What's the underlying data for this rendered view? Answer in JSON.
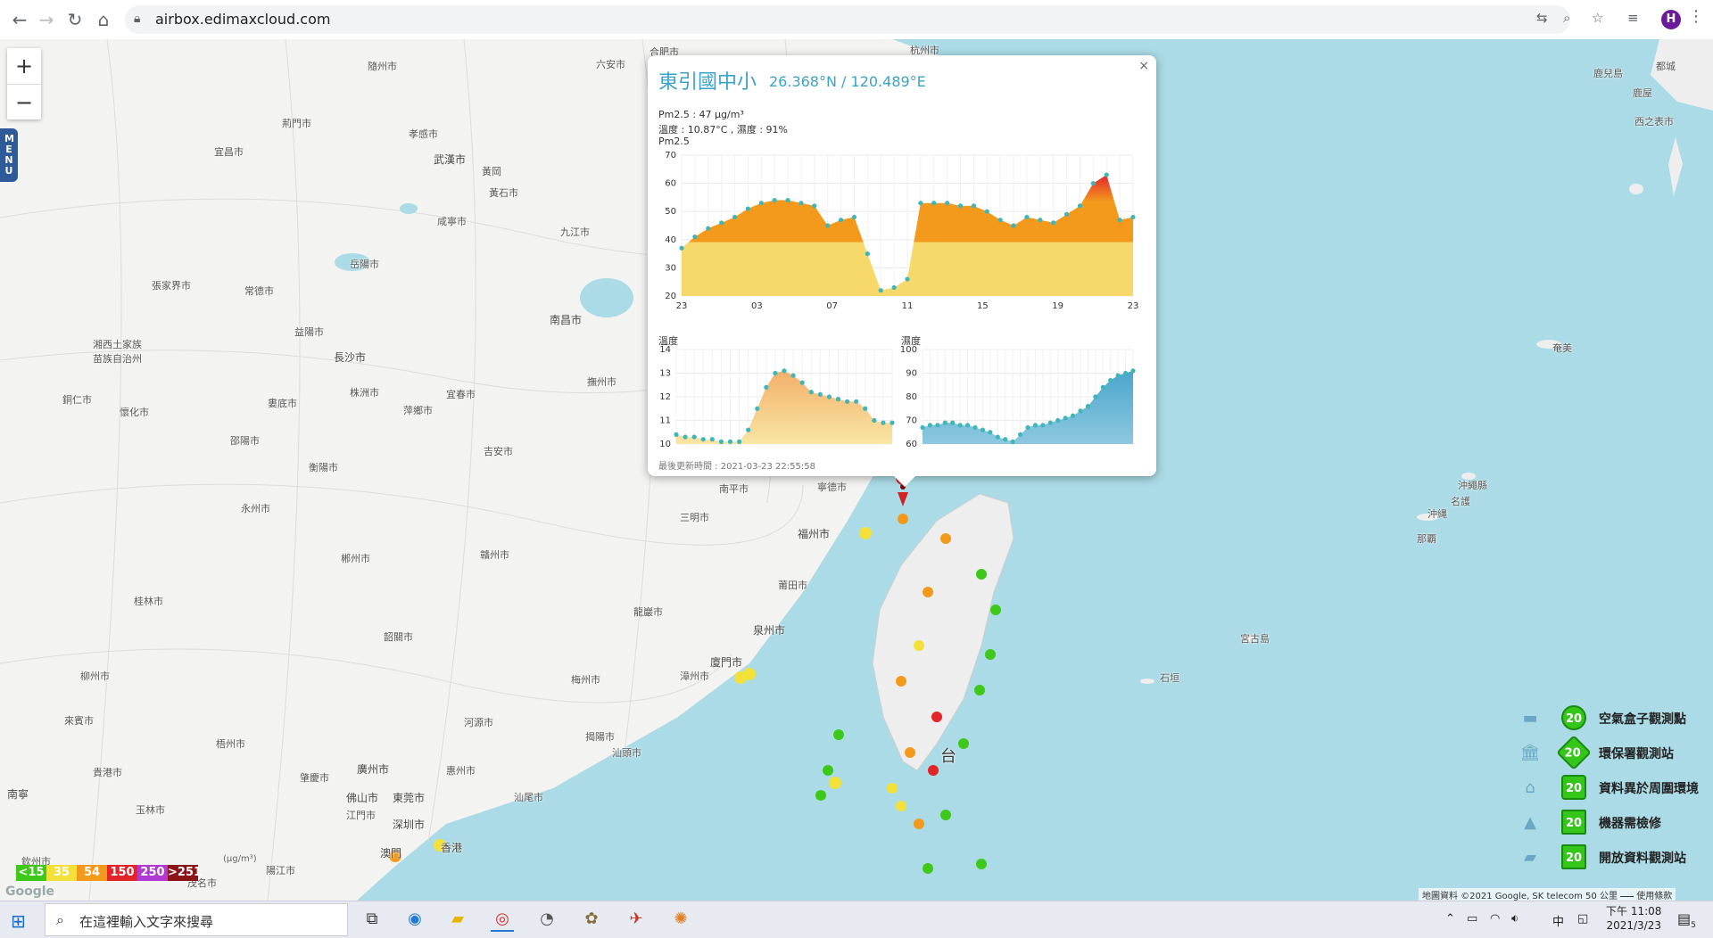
{
  "browser": {
    "url": "airbox.edimaxcloud.com",
    "profile_initial": "H",
    "icons": [
      "back-icon",
      "forward-icon",
      "reload-icon",
      "home-icon",
      "lock-icon",
      "translate-icon",
      "zoom-icon",
      "star-icon",
      "reading-list-icon",
      "menu-icon"
    ]
  },
  "map": {
    "zoom_in": "+",
    "zoom_out": "−",
    "menu_tab": "MENU",
    "labels": [
      {
        "t": "隨州市"
      },
      {
        "t": "荊門市"
      },
      {
        "t": "孝感市"
      },
      {
        "t": "宜昌市"
      },
      {
        "t": "武漢市"
      },
      {
        "t": "黃岡"
      },
      {
        "t": "黃石市"
      },
      {
        "t": "咸寧市"
      },
      {
        "t": "九江市"
      },
      {
        "t": "六安市"
      },
      {
        "t": "合肥市"
      },
      {
        "t": "杭州市"
      },
      {
        "t": "岳陽市"
      },
      {
        "t": "張家界市"
      },
      {
        "t": "常德市"
      },
      {
        "t": "益陽市"
      },
      {
        "t": "長沙市"
      },
      {
        "t": "南昌市"
      },
      {
        "t": "湘西土家族苗族自治州"
      },
      {
        "t": "株洲市"
      },
      {
        "t": "宜春市"
      },
      {
        "t": "撫州市"
      },
      {
        "t": "懷化市"
      },
      {
        "t": "銅仁市"
      },
      {
        "t": "婁底市"
      },
      {
        "t": "萍鄉市"
      },
      {
        "t": "邵陽市"
      },
      {
        "t": "吉安市"
      },
      {
        "t": "衡陽市"
      },
      {
        "t": "永州市"
      },
      {
        "t": "南平市"
      },
      {
        "t": "寧德市"
      },
      {
        "t": "三明市"
      },
      {
        "t": "福州市"
      },
      {
        "t": "郴州市"
      },
      {
        "t": "贛州市"
      },
      {
        "t": "莆田市"
      },
      {
        "t": "桂林市"
      },
      {
        "t": "龍巖市"
      },
      {
        "t": "泉州市"
      },
      {
        "t": "韶關市"
      },
      {
        "t": "廈門市"
      },
      {
        "t": "漳州市"
      },
      {
        "t": "梅州市"
      },
      {
        "t": "柳州市"
      },
      {
        "t": "河源市"
      },
      {
        "t": "揭陽市"
      },
      {
        "t": "汕頭市"
      },
      {
        "t": "來賓市"
      },
      {
        "t": "梧州市"
      },
      {
        "t": "肇慶市"
      },
      {
        "t": "廣州市"
      },
      {
        "t": "惠州市"
      },
      {
        "t": "佛山市"
      },
      {
        "t": "東莞市"
      },
      {
        "t": "汕尾市"
      },
      {
        "t": "貴港市"
      },
      {
        "t": "江門市"
      },
      {
        "t": "深圳市"
      },
      {
        "t": "香港"
      },
      {
        "t": "澳門"
      },
      {
        "t": "南寧"
      },
      {
        "t": "玉林市"
      },
      {
        "t": "欽州市"
      },
      {
        "t": "陽江市"
      },
      {
        "t": "茂名市"
      },
      {
        "t": "台"
      },
      {
        "t": "鹿兒島"
      },
      {
        "t": "都城"
      },
      {
        "t": "鹿屋"
      },
      {
        "t": "西之表市"
      },
      {
        "t": "奄美"
      },
      {
        "t": "沖繩縣"
      },
      {
        "t": "名護"
      },
      {
        "t": "沖縄"
      },
      {
        "t": "那覇"
      },
      {
        "t": "宮古島"
      },
      {
        "t": "石垣"
      }
    ],
    "legend": [
      {
        "label": "<15",
        "color": "#3ec91a"
      },
      {
        "label": "35",
        "color": "#f3e13a"
      },
      {
        "label": "54",
        "color": "#f39a1d"
      },
      {
        "label": "150",
        "color": "#e3242b"
      },
      {
        "label": "250",
        "color": "#b13bd2"
      },
      {
        "label": ">251",
        "color": "#8b1418"
      }
    ],
    "legend_unit": "(μg/m³)",
    "google_logo": "Google",
    "attribution": "地圖資料 ©2021 Google, SK telecom   50 公里 ⎯⎯⎯   使用條款"
  },
  "popup": {
    "title": "東引國中小",
    "coords": "26.368°N / 120.489°E",
    "pm_line": "Pm2.5 : 47 μg/m³",
    "temp_humid_line": "溫度 : 10.87°C , 濕度 : 91%",
    "pm_chart_label": "Pm2.5",
    "temp_label": "溫度",
    "humid_label": "濕度",
    "updated": "最後更新時間 : 2021-03-23 22:55:58",
    "close": "×"
  },
  "chart_data": [
    {
      "type": "area",
      "title": "Pm2.5",
      "categories": [
        "23",
        "03",
        "07",
        "11",
        "15",
        "19",
        "23"
      ],
      "ylim": [
        20,
        70
      ],
      "yticks": [
        20,
        30,
        40,
        50,
        60,
        70
      ],
      "series": [
        {
          "values": [
            37,
            41,
            44,
            46,
            48,
            51,
            53,
            54,
            54,
            53,
            52,
            45,
            47,
            48,
            35,
            22,
            23,
            26,
            53,
            53,
            53,
            52,
            52,
            50,
            47,
            45,
            48,
            47,
            46,
            49,
            52,
            60,
            63,
            47,
            48
          ]
        }
      ]
    },
    {
      "type": "area",
      "title": "溫度",
      "ylim": [
        10,
        14
      ],
      "yticks": [
        10,
        11,
        12,
        13,
        14
      ],
      "series": [
        {
          "values": [
            10.4,
            10.3,
            10.3,
            10.2,
            10.2,
            10.1,
            10.1,
            10.1,
            10.6,
            11.5,
            12.4,
            13.0,
            13.1,
            12.9,
            12.6,
            12.2,
            12.1,
            12.0,
            11.9,
            11.8,
            11.8,
            11.5,
            11.0,
            10.9,
            10.9
          ]
        }
      ]
    },
    {
      "type": "area",
      "title": "濕度",
      "ylim": [
        60,
        100
      ],
      "yticks": [
        60,
        70,
        80,
        90,
        100
      ],
      "series": [
        {
          "values": [
            67,
            68,
            68,
            69,
            69,
            68,
            68,
            67,
            66,
            65,
            63,
            62,
            61,
            64,
            67,
            68,
            68,
            69,
            70,
            71,
            72,
            74,
            76,
            80,
            84,
            87,
            89,
            90,
            91
          ]
        }
      ]
    }
  ],
  "key": [
    {
      "badge": "20",
      "label": "空氣盒子觀測點",
      "icon": "airbox-icon"
    },
    {
      "badge": "20",
      "label": "環保署觀測站",
      "icon": "epa-station-icon"
    },
    {
      "badge": "20",
      "label": "資料異於周圍環境",
      "icon": "house-icon"
    },
    {
      "badge": "20",
      "label": "機器需檢修",
      "icon": "warning-icon"
    },
    {
      "badge": "20",
      "label": "開放資料觀測站",
      "icon": "open-data-icon"
    }
  ],
  "taskbar": {
    "search_placeholder": "在這裡輸入文字來搜尋",
    "ime": "中",
    "time": "下午 11:08",
    "date": "2021/3/23",
    "notifications": "5"
  }
}
